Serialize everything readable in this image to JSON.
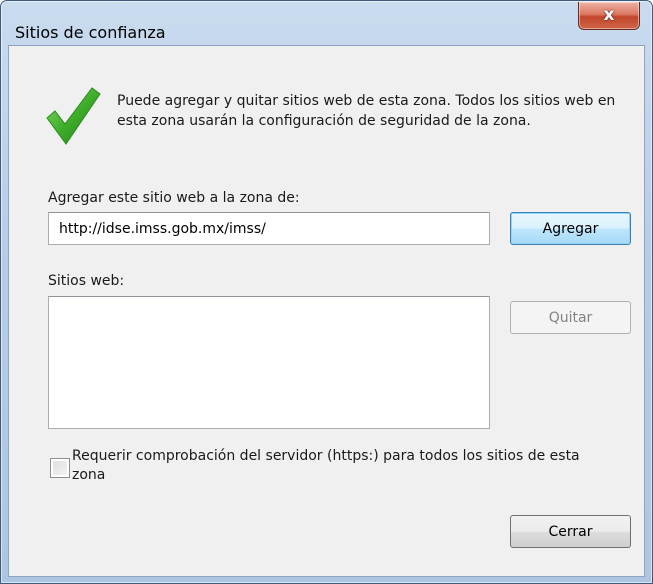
{
  "window": {
    "title": "Sitios de confianza",
    "close_glyph": "x"
  },
  "info": {
    "icon": "checkmark-icon",
    "message": "Puede agregar y quitar sitios web de esta zona. Todos los sitios web en esta zona usarán la configuración de seguridad de la zona."
  },
  "add": {
    "label": "Agregar este sitio web a la zona de:",
    "url_value": "http://idse.imss.gob.mx/imss/",
    "button_label": "Agregar"
  },
  "sites": {
    "label": "Sitios web:",
    "items": [],
    "remove_button_label": "Quitar"
  },
  "https_requirement": {
    "label": "Requerir comprobación del servidor (https:) para todos los sitios de esta zona",
    "checked": false
  },
  "footer": {
    "close_button_label": "Cerrar"
  },
  "colors": {
    "check_green": "#3fae2a",
    "close_red": "#c2472b",
    "frame_blue": "#b6cce6"
  }
}
